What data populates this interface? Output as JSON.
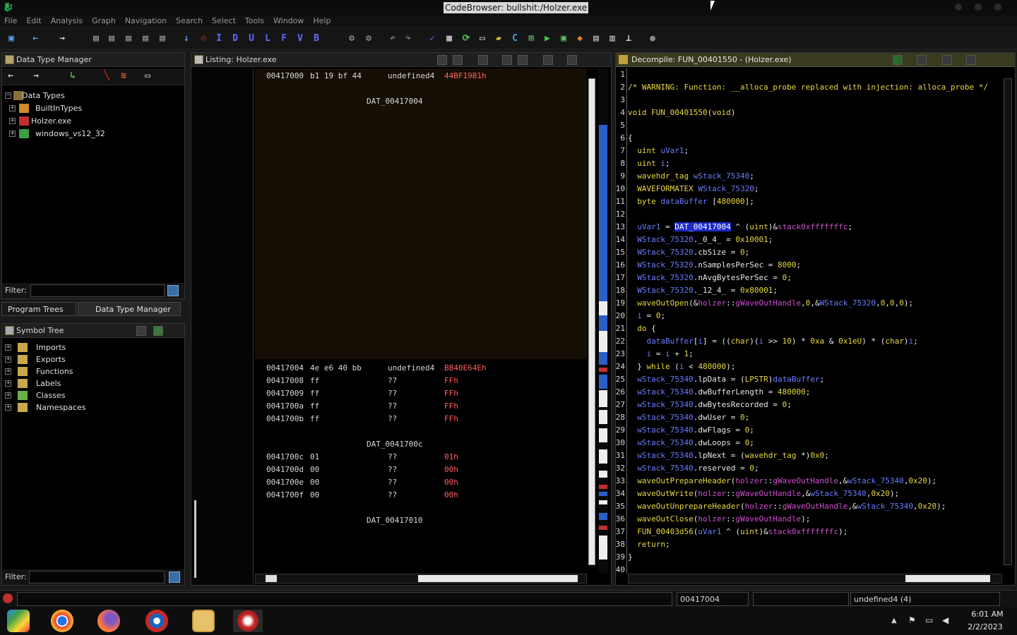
{
  "window": {
    "title": "CodeBrowser: bullshit:/Holzer.exe"
  },
  "menu": [
    "File",
    "Edit",
    "Analysis",
    "Graph",
    "Navigation",
    "Search",
    "Select",
    "Tools",
    "Window",
    "Help"
  ],
  "toolbar": {
    "letters": [
      "I",
      "D",
      "U",
      "L",
      "F",
      "V",
      "B"
    ]
  },
  "data_type_manager": {
    "title": "Data Type Manager",
    "root": "Data Types",
    "items": [
      "BuiltInTypes",
      "Holzer.exe",
      "windows_vs12_32"
    ],
    "filter_label": "Filter:"
  },
  "tabs": {
    "program_trees": "Program Trees",
    "data_type_manager": "Data Type Manager"
  },
  "symbol_tree": {
    "title": "Symbol Tree",
    "items": [
      "Imports",
      "Exports",
      "Functions",
      "Labels",
      "Classes",
      "Namespaces"
    ],
    "filter_label": "Filter:"
  },
  "listing": {
    "title": "Listing:  Holzer.exe",
    "rows": [
      {
        "addr": "00417000",
        "bytes": "b1 19 bf 44",
        "mnem": "undefined4",
        "oper": "44BF19B1h"
      },
      {
        "label": "DAT_00417004"
      },
      {
        "addr": "00417004",
        "bytes": "4e e6 40 bb",
        "mnem": "undefined4",
        "oper": "BB40E64Eh"
      },
      {
        "addr": "00417008",
        "bytes": "ff",
        "mnem": "??",
        "oper": "FFh"
      },
      {
        "addr": "00417009",
        "bytes": "ff",
        "mnem": "??",
        "oper": "FFh"
      },
      {
        "addr": "0041700a",
        "bytes": "ff",
        "mnem": "??",
        "oper": "FFh"
      },
      {
        "addr": "0041700b",
        "bytes": "ff",
        "mnem": "??",
        "oper": "FFh"
      },
      {
        "label": "DAT_0041700c"
      },
      {
        "addr": "0041700c",
        "bytes": "01",
        "mnem": "??",
        "oper": "01h"
      },
      {
        "addr": "0041700d",
        "bytes": "00",
        "mnem": "??",
        "oper": "00h"
      },
      {
        "addr": "0041700e",
        "bytes": "00",
        "mnem": "??",
        "oper": "00h"
      },
      {
        "addr": "0041700f",
        "bytes": "00",
        "mnem": "??",
        "oper": "00h"
      },
      {
        "label": "DAT_00417010"
      }
    ]
  },
  "decompile": {
    "title": "Decompile: FUN_00401550 -  (Holzer.exe)",
    "line_numbers": [
      "1",
      "2",
      "3",
      "4",
      "5",
      "6",
      "7",
      "8",
      "9",
      "10",
      "11",
      "12",
      "13",
      "14",
      "15",
      "16",
      "17",
      "18",
      "19",
      "20",
      "21",
      "22",
      "23",
      "24",
      "25",
      "26",
      "27",
      "28",
      "29",
      "30",
      "31",
      "32",
      "33",
      "34",
      "35",
      "36",
      "37",
      "38",
      "39",
      "40"
    ],
    "lines": [
      "",
      "/* WARNING: Function: __alloca_probe replaced with injection: alloca_probe */",
      "",
      "void FUN_00401550(void)",
      "",
      "{",
      "  uint uVar1;",
      "  uint i;",
      "  wavehdr_tag wStack_75340;",
      "  WAVEFORMATEX WStack_75320;",
      "  byte dataBuffer [480000];",
      "",
      "  uVar1 = DAT_00417004 ^ (uint)&stack0xfffffffc;",
      "  WStack_75320._0_4_ = 0x10001;",
      "  WStack_75320.cbSize = 0;",
      "  WStack_75320.nSamplesPerSec = 8000;",
      "  WStack_75320.nAvgBytesPerSec = 0;",
      "  WStack_75320._12_4_ = 0x80001;",
      "  waveOutOpen(&holzer::gWaveOutHandle,0,&WStack_75320,0,0,0);",
      "  i = 0;",
      "  do {",
      "    dataBuffer[i] = ((char)(i >> 10) * 0xa & 0x1eU) * (char)i;",
      "    i = i + 1;",
      "  } while (i < 480000);",
      "  wStack_75340.lpData = (LPSTR)dataBuffer;",
      "  wStack_75340.dwBufferLength = 480000;",
      "  wStack_75340.dwBytesRecorded = 0;",
      "  wStack_75340.dwUser = 0;",
      "  wStack_75340.dwFlags = 0;",
      "  wStack_75340.dwLoops = 0;",
      "  wStack_75340.lpNext = (wavehdr_tag *)0x0;",
      "  wStack_75340.reserved = 0;",
      "  waveOutPrepareHeader(holzer::gWaveOutHandle,&wStack_75340,0x20);",
      "  waveOutWrite(holzer::gWaveOutHandle,&wStack_75340,0x20);",
      "  waveOutUnprepareHeader(holzer::gWaveOutHandle,&wStack_75340,0x20);",
      "  waveOutClose(holzer::gWaveOutHandle);",
      "  FUN_00403d56(uVar1 ^ (uint)&stack0xfffffffc);",
      "  return;",
      "}",
      ""
    ]
  },
  "status": {
    "address": "00417004",
    "type": "undefined4 (4)"
  },
  "clock": {
    "time": "6:01 AM",
    "date": "2/2/2023"
  },
  "colors": {
    "background": "#000000",
    "highlight": "#1c2bc8",
    "keyword": "#e8d840",
    "variable": "#6a7cff",
    "global": "#d34fd3",
    "operand": "#ff6060"
  }
}
